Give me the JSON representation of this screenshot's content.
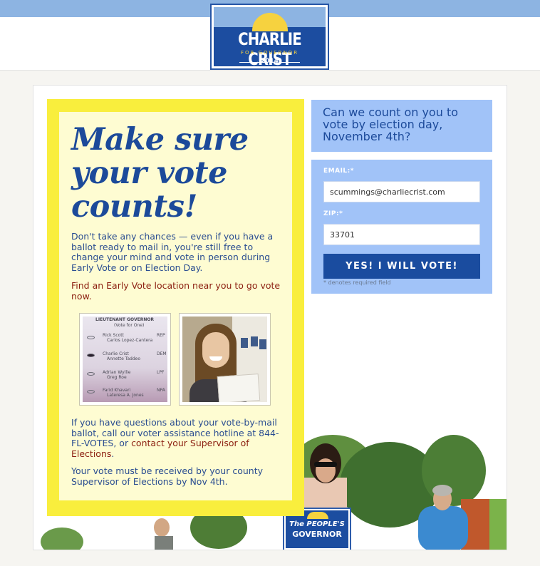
{
  "header": {
    "logo_name": "CHARLIE CRIST",
    "logo_sub": "FOR GOVERNOR",
    "logo_year": "2014"
  },
  "main": {
    "headline": "Make sure your vote counts!",
    "para1": "Don't take any chances — even if you have a ballot ready to mail in, you're still free to change your mind and vote in person during Early Vote or on Election Day.",
    "para2_link": "Find an Early Vote location near you to go vote now.",
    "para3_pre": "If you have questions about your vote-by-mail ballot, call our voter assistance hotline at 844-FL-VOTES, or ",
    "para3_link": "contact your Supervisor of Elections",
    "para3_post": ".",
    "para4": "Your vote must be received by your county Supervisor of Elections by Nov 4th."
  },
  "ballot": {
    "header": "LIEUTENANT GOVERNOR",
    "sub": "(Vote for One)",
    "rows": [
      {
        "line1": "Rick Scott",
        "line2": "Carlos Lopez-Cantera",
        "party": "REP"
      },
      {
        "line1": "Charlie Crist",
        "line2": "Annette Taddeo",
        "party": "DEM"
      },
      {
        "line1": "Adrian Wyllie",
        "line2": "Greg Roe",
        "party": "LPF"
      },
      {
        "line1": "Farid Khavari",
        "line2": "Lateresa A. Jones",
        "party": "NPA"
      }
    ]
  },
  "form": {
    "question": "Can we count on you to vote by election day, November 4th?",
    "email_label": "EMAIL:*",
    "email_value": "scummings@charliecrist.com",
    "zip_label": "ZIP:*",
    "zip_value": "33701",
    "submit_label": "YES! I WILL VOTE!",
    "note": "* denotes required field"
  },
  "photo": {
    "sign_line1": "The PEOPLE'S",
    "sign_line2": "GOVERNOR"
  },
  "colors": {
    "brand_blue": "#1a4c9f",
    "light_blue": "#a1c3f8",
    "yellow": "#f9ee3d",
    "link_red": "#8b1e0f"
  }
}
